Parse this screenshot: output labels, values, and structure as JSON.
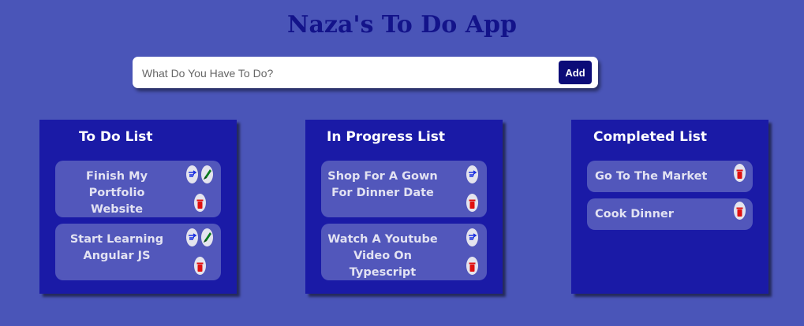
{
  "app_title": "Naza's To Do App",
  "input": {
    "placeholder": "What Do You Have To Do?",
    "value": ""
  },
  "add_label": "Add",
  "lists": {
    "todo": {
      "title": "To Do List",
      "items": [
        {
          "text": "Finish My Portfolio Website"
        },
        {
          "text": "Start Learning Angular JS"
        }
      ]
    },
    "progress": {
      "title": "In Progress List",
      "items": [
        {
          "text": "Shop For A Gown For Dinner Date"
        },
        {
          "text": "Watch A Youtube Video On Typescript"
        }
      ]
    },
    "completed": {
      "title": "Completed List",
      "items": [
        {
          "text": "Go To The Market"
        },
        {
          "text": "Cook Dinner"
        }
      ]
    }
  },
  "icons": {
    "start": "pointing-hand-icon",
    "complete": "green-pen-icon",
    "delete": "red-trash-icon"
  },
  "colors": {
    "background": "#4a55b8",
    "list_panel": "#1a1aa6",
    "task_card": "#5257bb",
    "title": "#13138a",
    "add_button": "#0c0c78",
    "start_icon": "#1a2fe0",
    "complete_icon": "#0a7a1e",
    "delete_icon": "#e01010"
  }
}
